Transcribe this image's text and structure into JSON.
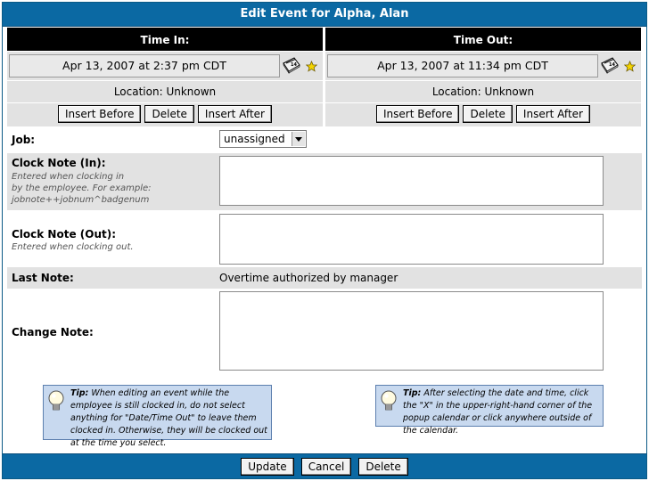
{
  "window": {
    "title": "Edit Event for Alpha, Alan"
  },
  "time_in": {
    "header": "Time In:",
    "datetime": "Apr 13, 2007 at 2:37 pm CDT",
    "location": "Location: Unknown",
    "buttons": {
      "insert_before": "Insert Before",
      "delete": "Delete",
      "insert_after": "Insert After"
    }
  },
  "time_out": {
    "header": "Time Out:",
    "datetime": "Apr 13, 2007 at 11:34 pm CDT",
    "location": "Location: Unknown",
    "buttons": {
      "insert_before": "Insert Before",
      "delete": "Delete",
      "insert_after": "Insert After"
    }
  },
  "form": {
    "job": {
      "label": "Job:",
      "value": "unassigned"
    },
    "clock_note_in": {
      "label": "Clock Note (In):",
      "help_lines": [
        "Entered when clocking in",
        "by the employee. For example:",
        "jobnote++jobnum^badgenum"
      ],
      "value": ""
    },
    "clock_note_out": {
      "label": "Clock Note (Out):",
      "help": "Entered when clocking out.",
      "value": ""
    },
    "last_note": {
      "label": "Last Note:",
      "value": "Overtime authorized by manager"
    },
    "change_note": {
      "label": "Change Note:",
      "value": ""
    }
  },
  "tips": [
    {
      "title": "Tip:",
      "text": " When editing an event while the employee is still clocked in, do not select anything for \"Date/Time Out\" to leave them clocked in. Otherwise, they will be clocked out at the time you select."
    },
    {
      "title": "Tip:",
      "text": " After selecting the date and time, click the \"X\" in the upper-right-hand corner of the popup calendar or click anywhere outside of the calendar."
    }
  ],
  "footer": {
    "update": "Update",
    "cancel": "Cancel",
    "delete": "Delete"
  },
  "colors": {
    "title_bar": "#0b69a3",
    "header_black": "#000000",
    "row_gray": "#e2e2e2",
    "tip_bg": "#c8d9ef",
    "star": "#f4d400"
  },
  "icons": {
    "calendar": "calendar-icon",
    "favorite": "star-icon",
    "tip": "lightbulb-icon"
  }
}
